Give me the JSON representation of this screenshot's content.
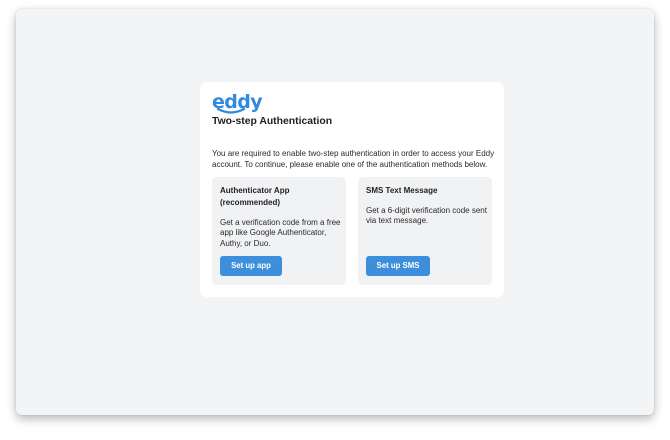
{
  "brand": {
    "logo_text": "eddy",
    "color": "#2f8ae0"
  },
  "page": {
    "title": "Two-step Authentication",
    "description": "You are required to enable two-step authentication in order to access your Eddy account. To continue, please enable one of the authentication methods below."
  },
  "options": [
    {
      "title": "Authenticator App (recommended)",
      "description": "Get a verification code from a free app like Google Authenticator, Authy, or Duo.",
      "button_label": "Set up app"
    },
    {
      "title": "SMS Text Message",
      "description": "Get a 6-digit verification code sent via text message.",
      "button_label": "Set up SMS"
    }
  ],
  "colors": {
    "button": "#3d8fdc",
    "background": "#f3f4f6",
    "card": "#ffffff",
    "option_background": "#f1f2f4"
  }
}
